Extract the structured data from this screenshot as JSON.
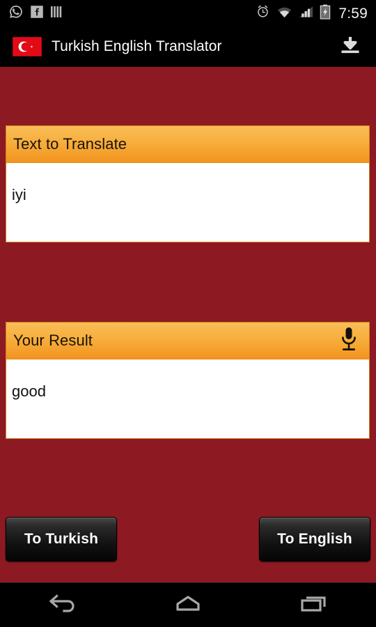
{
  "status_bar": {
    "left_icons": [
      {
        "name": "whatsapp-icon",
        "label": "WhatsApp"
      },
      {
        "name": "facebook-icon",
        "label": "Facebook"
      },
      {
        "name": "bars-icon",
        "label": "Bars"
      }
    ],
    "right_icons": [
      {
        "name": "alarm-clock-icon",
        "label": "Alarm"
      },
      {
        "name": "wifi-icon",
        "label": "Wi-Fi"
      },
      {
        "name": "cellular-signal-icon",
        "label": "Signal"
      },
      {
        "name": "battery-charging-icon",
        "label": "Battery charging"
      }
    ],
    "clock": "7:59"
  },
  "app_bar": {
    "flag_icon": "turkish-flag-icon",
    "title": "Turkish English Translator",
    "action_icon": "download-icon"
  },
  "input_card": {
    "header": "Text to Translate",
    "value": "iyi",
    "placeholder": ""
  },
  "result_card": {
    "header": "Your Result",
    "mic_icon": "microphone-icon",
    "value": "good",
    "placeholder": ""
  },
  "buttons": {
    "to_turkish": "To Turkish",
    "to_english": "To English"
  },
  "nav_bar": {
    "back": "back-icon",
    "home": "home-icon",
    "recents": "recents-icon"
  },
  "colors": {
    "background_red": "#8D1A22",
    "header_orange_top": "#F9BD57",
    "header_orange_bottom": "#F29320",
    "card_white": "#FFFFFF",
    "bar_black": "#000000",
    "flag_red": "#E30A17"
  }
}
